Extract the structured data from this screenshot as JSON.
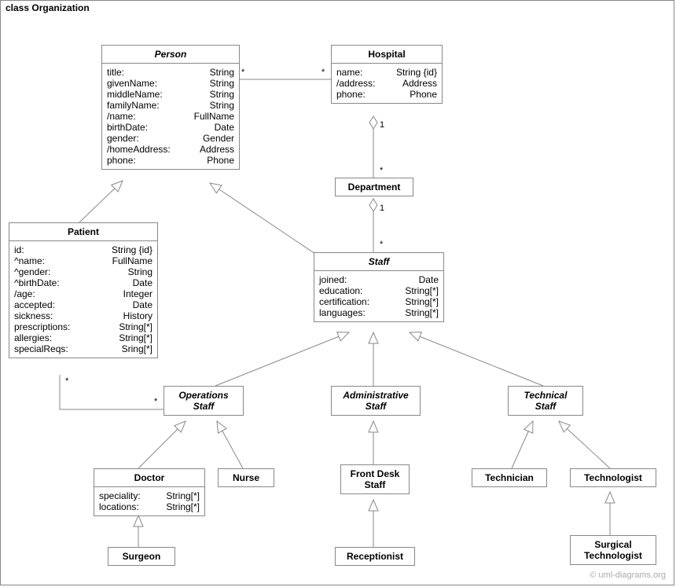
{
  "frame": {
    "title": "class Organization"
  },
  "watermark": "© uml-diagrams.org",
  "classes": {
    "person": {
      "name": "Person",
      "attrs": [
        {
          "n": "title:",
          "t": "String"
        },
        {
          "n": "givenName:",
          "t": "String"
        },
        {
          "n": "middleName:",
          "t": "String"
        },
        {
          "n": "familyName:",
          "t": "String"
        },
        {
          "n": "/name:",
          "t": "FullName"
        },
        {
          "n": "birthDate:",
          "t": "Date"
        },
        {
          "n": "gender:",
          "t": "Gender"
        },
        {
          "n": "/homeAddress:",
          "t": "Address"
        },
        {
          "n": "phone:",
          "t": "Phone"
        }
      ]
    },
    "hospital": {
      "name": "Hospital",
      "attrs": [
        {
          "n": "name:",
          "t": "String {id}"
        },
        {
          "n": "/address:",
          "t": "Address"
        },
        {
          "n": "phone:",
          "t": "Phone"
        }
      ]
    },
    "department": {
      "name": "Department"
    },
    "patient": {
      "name": "Patient",
      "attrs": [
        {
          "n": "id:",
          "t": "String {id}"
        },
        {
          "n": "^name:",
          "t": "FullName"
        },
        {
          "n": "^gender:",
          "t": "String"
        },
        {
          "n": "^birthDate:",
          "t": "Date"
        },
        {
          "n": "/age:",
          "t": "Integer"
        },
        {
          "n": "accepted:",
          "t": "Date"
        },
        {
          "n": "sickness:",
          "t": "History"
        },
        {
          "n": "prescriptions:",
          "t": "String[*]"
        },
        {
          "n": "allergies:",
          "t": "String[*]"
        },
        {
          "n": "specialReqs:",
          "t": "Sring[*]"
        }
      ]
    },
    "staff": {
      "name": "Staff",
      "attrs": [
        {
          "n": "joined:",
          "t": "Date"
        },
        {
          "n": "education:",
          "t": "String[*]"
        },
        {
          "n": "certification:",
          "t": "String[*]"
        },
        {
          "n": "languages:",
          "t": "String[*]"
        }
      ]
    },
    "opsStaff": {
      "name": "Operations",
      "name2": "Staff"
    },
    "adminStaff": {
      "name": "Administrative",
      "name2": "Staff"
    },
    "techStaff": {
      "name": "Technical",
      "name2": "Staff"
    },
    "doctor": {
      "name": "Doctor",
      "attrs": [
        {
          "n": "speciality:",
          "t": "String[*]"
        },
        {
          "n": "locations:",
          "t": "String[*]"
        }
      ]
    },
    "nurse": {
      "name": "Nurse"
    },
    "frontDesk": {
      "name": "Front Desk",
      "name2": "Staff"
    },
    "technician": {
      "name": "Technician"
    },
    "technologist": {
      "name": "Technologist"
    },
    "surgeon": {
      "name": "Surgeon"
    },
    "receptionist": {
      "name": "Receptionist"
    },
    "surgTech": {
      "name": "Surgical",
      "name2": "Technologist"
    }
  },
  "mults": {
    "person_hospital_left": "*",
    "person_hospital_right": "*",
    "hospital_dept_top": "1",
    "hospital_dept_bottom": "*",
    "dept_staff_top": "1",
    "dept_staff_bottom": "*",
    "patient_ops_left": "*",
    "patient_ops_right": "*"
  }
}
